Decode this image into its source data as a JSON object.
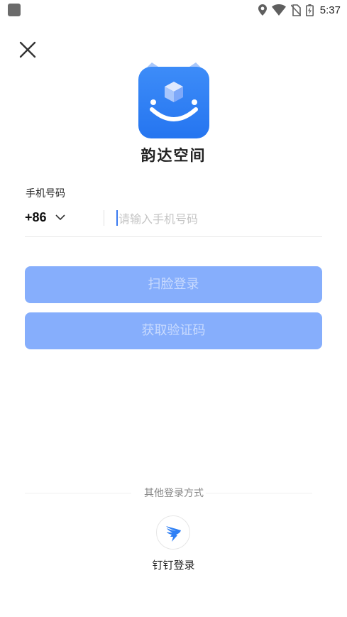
{
  "status_bar": {
    "time": "5:37",
    "icons": [
      "location-icon",
      "wifi-icon",
      "no-sim-icon",
      "battery-charging-icon"
    ]
  },
  "header": {
    "close_icon": "close-icon"
  },
  "app": {
    "name": "韵达空间",
    "logo": "app-logo-icon",
    "brand_color": "#2f80f5"
  },
  "phone": {
    "label": "手机号码",
    "country_code": "+86",
    "placeholder": "请输入手机号码",
    "value": ""
  },
  "buttons": {
    "face_login": "扫脸登录",
    "get_code": "获取验证码",
    "disabled_color": "#86aefc"
  },
  "other_login": {
    "title": "其他登录方式",
    "dingtalk_label": "钉钉登录",
    "dingtalk_icon": "dingtalk-icon"
  }
}
